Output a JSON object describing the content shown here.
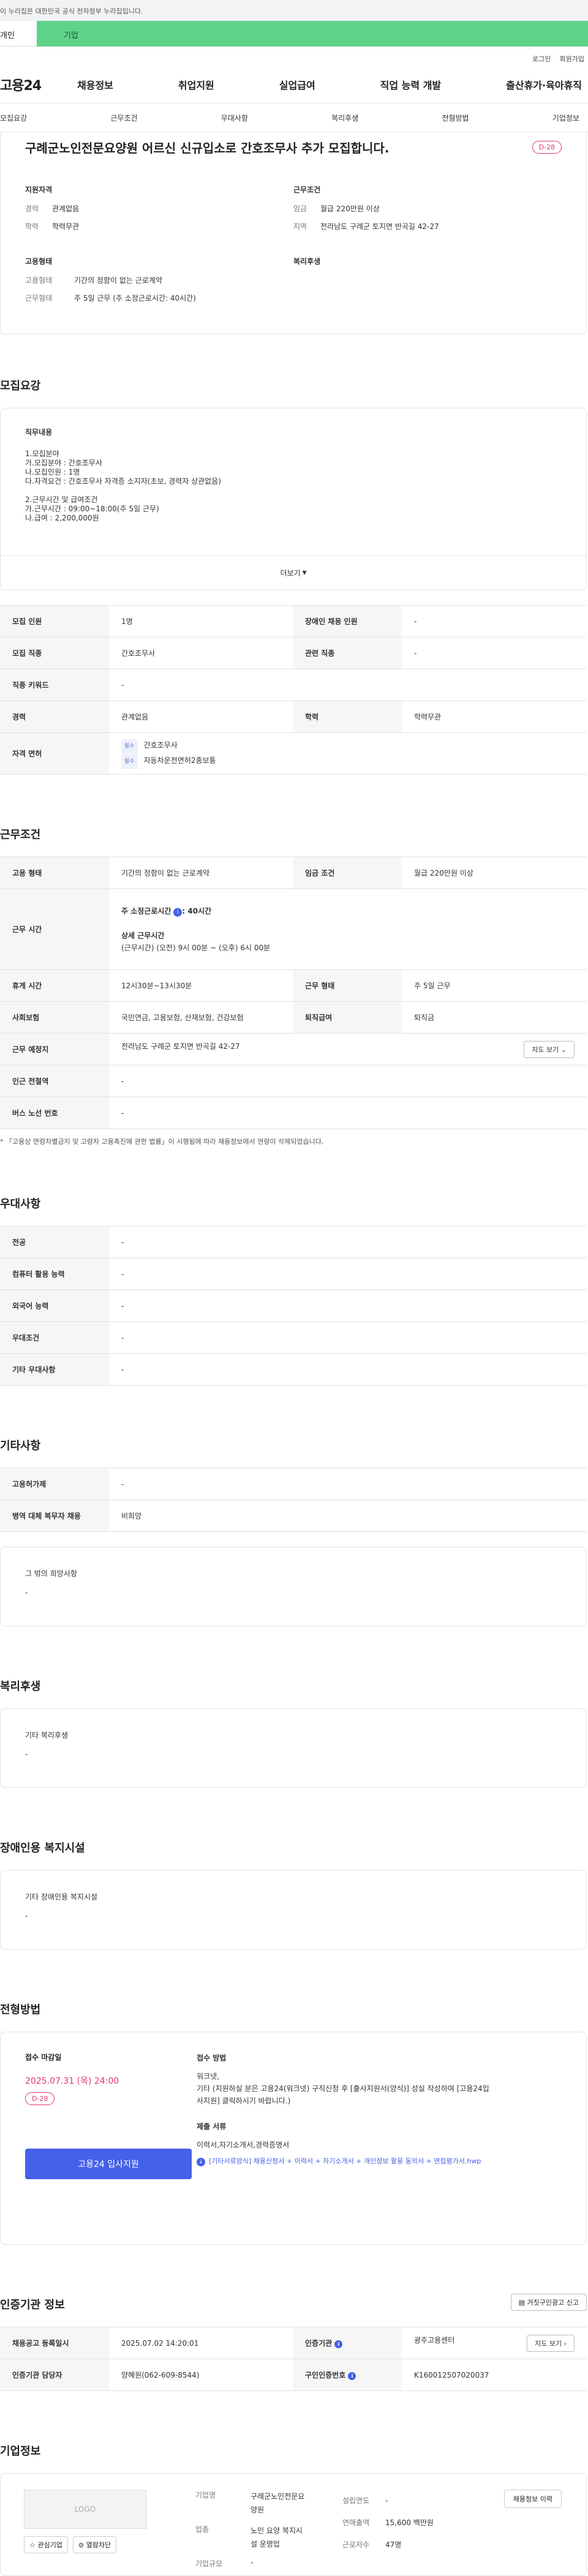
{
  "notice": "이 누리집은 대한민국 공식 전자정부 누리집입니다.",
  "user_tabs": [
    "개인",
    "기업"
  ],
  "util": [
    "로그인",
    "회원가입"
  ],
  "logo": "고용24",
  "gnb": [
    "채용정보",
    "취업지원",
    "실업급여",
    "직업 능력 개발",
    "출산휴가·육아휴직"
  ],
  "subnav": [
    "모집요강",
    "근무조건",
    "우대사항",
    "복리후생",
    "전형방법",
    "기업정보"
  ],
  "summary": {
    "title": "구례군노인전문요양원 어르신 신규입소로 간호조무사 추가 모집합니다.",
    "dday": "D-28",
    "qual_h": "지원자격",
    "qual": [
      [
        "경력",
        "관계없음"
      ],
      [
        "학력",
        "학력무관"
      ]
    ],
    "cond_h": "근무조건",
    "cond": [
      [
        "임금",
        "월급 220만원 이상"
      ],
      [
        "지역",
        "전라남도 구례군 토지면 반곡길 42-27"
      ]
    ],
    "emp_h": "고용형태",
    "emp": [
      [
        "고용형태",
        "기간의 정함이 없는 근로계약"
      ],
      [
        "근무형태",
        "주 5일 근무 (주 소정근로시간: 40시간)"
      ]
    ],
    "welfare_h": "복리후생"
  },
  "recruit": {
    "title": "모집요강",
    "job_h": "직무내용",
    "lines": [
      "1.모집분야",
      " 가.모집분야 : 간호조무사",
      " 나.모집인원 : 1명",
      " 다.자격요건 : 간호조무사 자격증 소지자(초보, 경력자 상관없음)",
      "",
      "2.근무시간 및 급여조건",
      " 가.근무시간 : 09:00~18:00(주 5일 근무)",
      " 나.급여 : 2,200,000원"
    ],
    "more": "더보기",
    "table": {
      "row1": [
        "모집 인원",
        "1명",
        "장애인 채용 인원",
        "-"
      ],
      "row2": [
        "모집 직종",
        "간호조무사",
        "관련 직종",
        "-"
      ],
      "row3": [
        "직종 키워드",
        "-"
      ],
      "row4": [
        "경력",
        "관계없음",
        "학력",
        "학력무관"
      ],
      "license_k": "자격 면허",
      "license_tag": "필수",
      "licenses": [
        "간호조무사",
        "자동차운전면허2종보통"
      ]
    }
  },
  "work": {
    "title": "근무조건",
    "r1": [
      "고용 형태",
      "기간의 정함이 없는 근로계약",
      "임금 조건",
      "월급 220만원 이상"
    ],
    "hours_k": "근무 시간",
    "hours_main": "주 소정근로시간",
    "hours_info": "i",
    "hours_val": ": 40시간",
    "hours_detail_h": "상세 근무시간",
    "hours_detail": "(근무시간) (오전) 9시 00분 ~ (오후) 6시 00분",
    "r3": [
      "휴게 시간",
      "12시30분~13시30분",
      "근무 형태",
      "주 5일 근무"
    ],
    "r4": [
      "사회보험",
      "국민연금, 고용보험, 산재보험, 건강보험",
      "퇴직급여",
      "퇴직금"
    ],
    "r5": [
      "근무 예정지",
      "전라남도 구례군 토지면 반곡길 42-27"
    ],
    "map_btn": "지도 보기",
    "r6": [
      "인근 전철역",
      "-"
    ],
    "r7": [
      "버스 노선 번호",
      "-"
    ],
    "note": "* 「고용상 연령차별금지 및 고령자 고용촉진에 관한 법률」이 시행됨에 따라 채용정보에서 연령이 삭제되었습니다."
  },
  "pref": {
    "title": "우대사항",
    "rows": [
      [
        "전공",
        "-"
      ],
      [
        "컴퓨터 활용 능력",
        "-"
      ],
      [
        "외국어 능력",
        "-"
      ],
      [
        "우대조건",
        "-"
      ],
      [
        "기타 우대사항",
        "-"
      ]
    ]
  },
  "etc": {
    "title": "기타사항",
    "rows": [
      [
        "고용허가제",
        "-"
      ],
      [
        "병역 대체 복무자 채용",
        "비희망"
      ]
    ],
    "other_h": "그 밖의 희망사항",
    "other_v": "-"
  },
  "welfare": {
    "title": "복리후생",
    "h": "기타 복리후생",
    "v": "-"
  },
  "disab": {
    "title": "장애인용 복지시설",
    "h": "기타 장애인용 복지시설",
    "v": "-"
  },
  "selection": {
    "title": "전형방법",
    "deadline_h": "접수 마감일",
    "deadline": "2025.07.31 (목) 24:00",
    "dday": "D-28",
    "apply_btn": "고용24 입사지원",
    "method_h": "접수 방법",
    "method_1": "워크넷,",
    "method_2": "기타 (지원하실 분은 고용24(워크넷) 구직신청 후 [출사지원서(양식)] 성실 작성하여 [고용24입",
    "method_3": "사지원] 클릭하시기 바랍니다.)",
    "docs_h": "제출 서류",
    "docs": "이력서,자기소개서,경력증명서",
    "doc_file": "[기타서류양식] 채용신청서 + 이력서 + 자기소개서 + 개인정보 활용 동의서 + 면접평가서.hwp"
  },
  "cert": {
    "title": "인증기관 정보",
    "report_btn": "거짓구인광고 신고",
    "r1": [
      "채용공고 등록일시",
      "2025.07.02 14:20:01",
      "인증기관",
      "광주고용센터"
    ],
    "map_btn": "지도 보기",
    "r2": [
      "인증기관 담당자",
      "양혜원(062-609-8544)",
      "구인인증번호",
      "K160012507020037"
    ]
  },
  "company": {
    "title": "기업정보",
    "logo": "LOGO",
    "fav_btn": "관심기업",
    "block_btn": "열람차단",
    "name_k": "기업명",
    "name_v": [
      "구례군노인전문요",
      "양원"
    ],
    "industry_k": "업종",
    "industry_v": [
      "노인 요양 복지시",
      "설 운영업"
    ],
    "scale_k": "기업규모",
    "scale_v": "-",
    "founded_k": "설립연도",
    "founded_v": "-",
    "sales_k": "연매출액",
    "sales_v": "15,600 백만원",
    "emp_k": "근로자수",
    "emp_v": "47명",
    "history_btn": "채용정보 이력"
  }
}
